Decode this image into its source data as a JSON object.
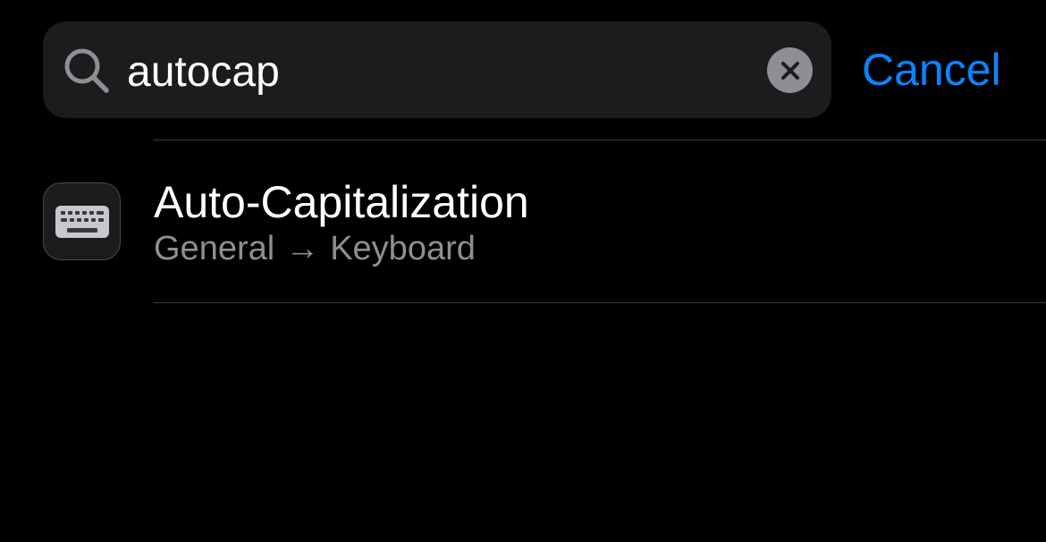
{
  "search": {
    "value": "autocap",
    "icon": "magnifying-glass",
    "clear_icon": "xmark-circle"
  },
  "cancel_label": "Cancel",
  "results": [
    {
      "icon": "keyboard",
      "title": "Auto-Capitalization",
      "path_section": "General",
      "path_arrow": "→",
      "path_item": "Keyboard"
    }
  ],
  "colors": {
    "background": "#000000",
    "search_field": "#1c1c1e",
    "accent": "#0a84ff",
    "secondary_text": "#8e8e93",
    "separator": "#38383a"
  }
}
